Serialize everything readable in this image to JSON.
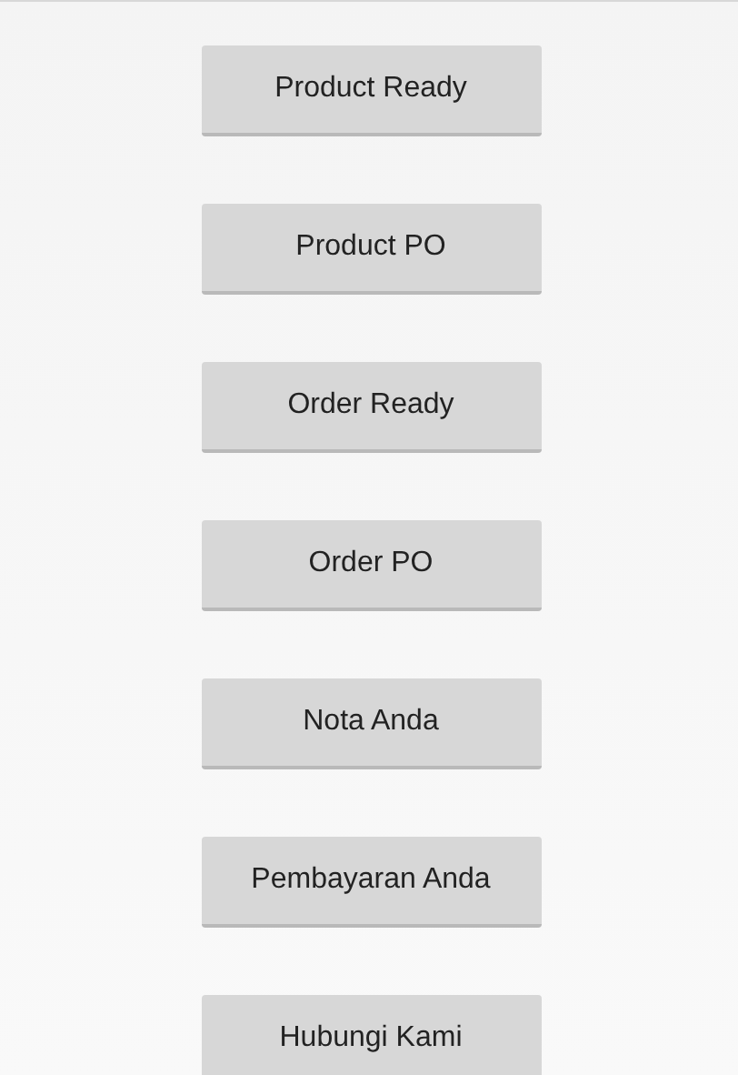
{
  "buttons": [
    {
      "label": "Product Ready"
    },
    {
      "label": "Product PO"
    },
    {
      "label": "Order Ready"
    },
    {
      "label": "Order PO"
    },
    {
      "label": "Nota Anda"
    },
    {
      "label": "Pembayaran Anda"
    },
    {
      "label": "Hubungi Kami"
    }
  ]
}
